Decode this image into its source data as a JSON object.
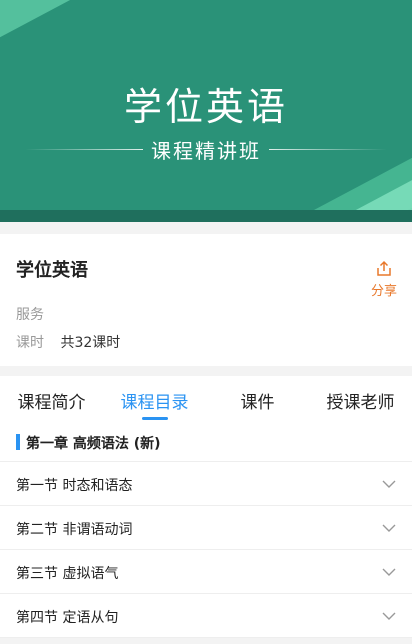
{
  "banner": {
    "title": "学位英语",
    "subtitle": "课程精讲班"
  },
  "course": {
    "name": "学位英语",
    "share_label": "分享",
    "service_label": "服务",
    "service_value": "",
    "hours_label": "课时",
    "hours_value": "共32课时"
  },
  "tabs": [
    {
      "label": "课程简介",
      "active": false
    },
    {
      "label": "课程目录",
      "active": true
    },
    {
      "label": "课件",
      "active": false
    },
    {
      "label": "授课老师",
      "active": false
    }
  ],
  "catalog": {
    "chapter": "第一章 高频语法 (新)",
    "sections": [
      {
        "label": "第一节 时态和语态"
      },
      {
        "label": "第二节 非谓语动词"
      },
      {
        "label": "第三节 虚拟语气"
      },
      {
        "label": "第四节 定语从句"
      }
    ]
  },
  "colors": {
    "banner": "#2a9278",
    "accent": "#2a93f2",
    "share": "#e8782b"
  },
  "icons": {
    "share": "share-icon",
    "chevron": "chevron-down-icon"
  }
}
